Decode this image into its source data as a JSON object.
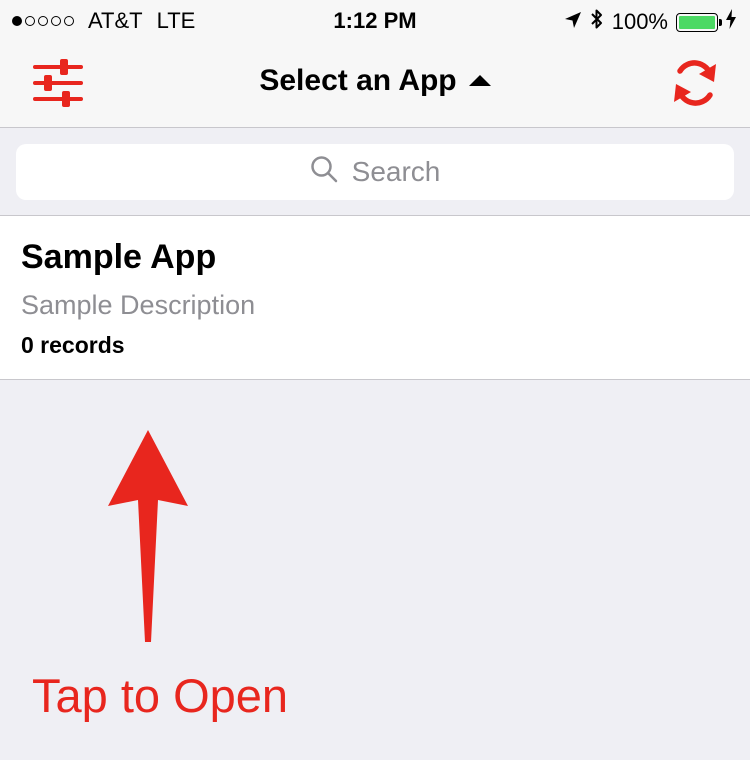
{
  "status_bar": {
    "carrier": "AT&T",
    "network": "LTE",
    "time": "1:12 PM",
    "battery_percent": "100%",
    "battery_level": 1.0,
    "signal_bars_filled": 1,
    "signal_bars_total": 5
  },
  "nav": {
    "title": "Select an App",
    "left_icon": "sliders-icon",
    "right_icon": "sync-icon",
    "accent_color": "#e8261e"
  },
  "search": {
    "placeholder": "Search"
  },
  "apps": [
    {
      "name": "Sample App",
      "description": "Sample Description",
      "records": "0 records"
    }
  ],
  "annotation": {
    "text": "Tap to Open",
    "color": "#e8261e"
  }
}
